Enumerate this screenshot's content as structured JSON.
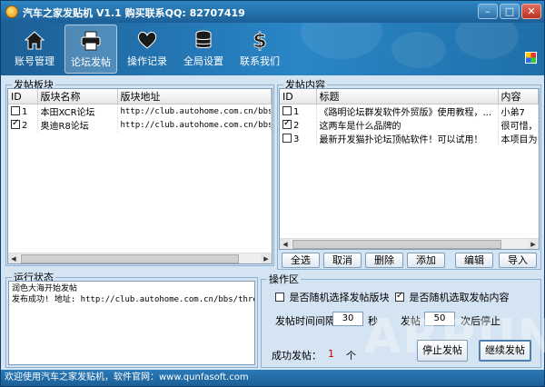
{
  "window": {
    "title": "汽车之家发贴机 V1.1 购买联系QQ: 82707419",
    "controls": [
      "minimize",
      "maximize",
      "close"
    ]
  },
  "toolbar": {
    "items": [
      {
        "label": "账号管理",
        "icon": "home-icon",
        "active": false
      },
      {
        "label": "论坛发帖",
        "icon": "printer-icon",
        "active": true
      },
      {
        "label": "操作记录",
        "icon": "heart-icon",
        "active": false
      },
      {
        "label": "全局设置",
        "icon": "database-icon",
        "active": false
      },
      {
        "label": "联系我们",
        "icon": "dollar-icon",
        "active": false
      }
    ],
    "skin_icon": "palette-icon"
  },
  "board_panel": {
    "legend": "发帖板块",
    "columns": [
      "ID",
      "版块名称",
      "版块地址"
    ],
    "rows": [
      {
        "checked": false,
        "id": "1",
        "name": "本田XCR论坛",
        "url": "http://club.autohome.com.cn/bbs/for"
      },
      {
        "checked": true,
        "id": "2",
        "name": "奥迪R8论坛",
        "url": "http://club.autohome.com.cn/bbs/for"
      }
    ]
  },
  "content_panel": {
    "legend": "发帖内容",
    "columns": [
      "ID",
      "标题",
      "内容"
    ],
    "rows": [
      {
        "checked": false,
        "id": "1",
        "title": "《路明论坛群发软件外贸版》使用教程，...",
        "content": "小弟7"
      },
      {
        "checked": true,
        "id": "2",
        "title": "这两车是什么品牌的",
        "content": "很可惜，"
      },
      {
        "checked": false,
        "id": "3",
        "title": "最新开发猫扑论坛顶帖软件！可以试用！",
        "content": "本项目为"
      }
    ],
    "buttons": [
      "全选",
      "取消",
      "删除",
      "添加",
      "编辑",
      "导入"
    ]
  },
  "status_panel": {
    "legend": "运行状态",
    "lines": [
      "润色大海开始发帖",
      "发布成功! 地址: http://club.autohome.com.cn/bbs/thread-"
    ]
  },
  "ops_panel": {
    "legend": "操作区",
    "random_board_label": "是否随机选择发帖版块",
    "random_board_checked": false,
    "random_content_label": "是否随机选取发帖内容",
    "random_content_checked": true,
    "interval_label": "发帖时间间隔",
    "interval_value": "30",
    "interval_unit": "秒",
    "count_label": "发帖",
    "count_value": "50",
    "count_suffix": "次后停止",
    "success_label": "成功发帖：",
    "success_value": "1",
    "success_unit": "个",
    "stop_button": "停止发帖",
    "continue_button": "继续发帖"
  },
  "watermark": "ARPUN",
  "statusbar": {
    "text": "欢迎使用汽车之家发贴机，软件官网：www.qunfasoft.com"
  },
  "colors": {
    "title_bar": "#1c5f96",
    "panel_bg": "#d4e4f2",
    "success_count": "#d00000"
  }
}
